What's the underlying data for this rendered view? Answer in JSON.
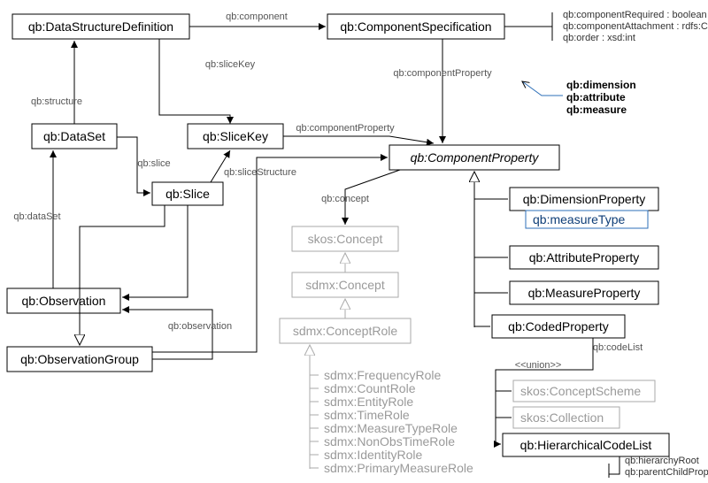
{
  "classes": {
    "dsd": "qb:DataStructureDefinition",
    "compSpec": "qb:ComponentSpecification",
    "dataSet": "qb:DataSet",
    "sliceKey": "qb:SliceKey",
    "slice": "qb:Slice",
    "observation": "qb:Observation",
    "obsGroup": "qb:ObservationGroup",
    "compProp": "qb:ComponentProperty",
    "dimProp": "qb:DimensionProperty",
    "measureType": "qb:measureType",
    "attrProp": "qb:AttributeProperty",
    "measProp": "qb:MeasureProperty",
    "codedProp": "qb:CodedProperty",
    "hcl": "qb:HierarchicalCodeList",
    "skosConcept": "skos:Concept",
    "sdmxConcept": "sdmx:Concept",
    "sdmxConceptRole": "sdmx:ConceptRole",
    "skosConceptScheme": "skos:ConceptScheme",
    "skosCollection": "skos:Collection"
  },
  "edges": {
    "component": "qb:component",
    "structure": "qb:structure",
    "sliceKey": "qb:sliceKey",
    "slice": "qb:slice",
    "sliceStructure": "qb:sliceStructure",
    "dataSet": "qb:dataSet",
    "observation": "qb:observation",
    "componentProperty": "qb:componentProperty",
    "concept": "qb:concept",
    "codeList": "qb:codeList",
    "union": "<<union>>",
    "hierarchyRoot": "qb:hierarchyRoot",
    "parentChild": "qb:parentChildProperty"
  },
  "attrs": {
    "compReq": "qb:componentRequired : boolean",
    "compAtt": "qb:componentAttachment : rdfs:Class",
    "order": "qb:order : xsd:int",
    "dim": "qb:dimension",
    "attr": "qb:attribute",
    "meas": "qb:measure"
  },
  "roles": {
    "freq": "sdmx:FrequencyRole",
    "count": "sdmx:CountRole",
    "entity": "sdmx:EntityRole",
    "time": "sdmx:TimeRole",
    "mtype": "sdmx:MeasureTypeRole",
    "nonobs": "sdmx:NonObsTimeRole",
    "ident": "sdmx:IdentityRole",
    "primary": "sdmx:PrimaryMeasureRole"
  }
}
